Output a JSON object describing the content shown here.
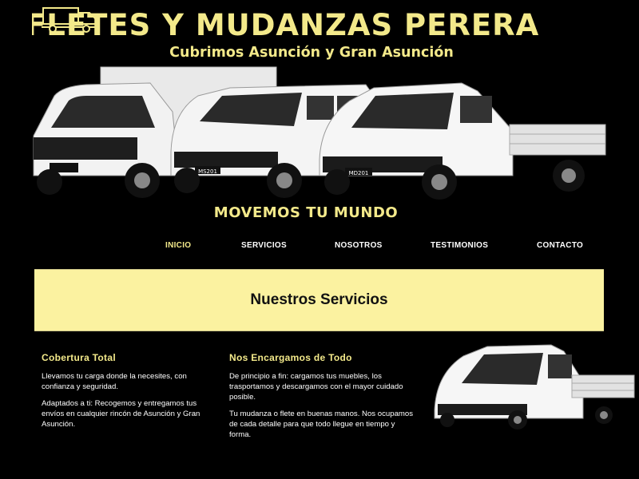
{
  "hero": {
    "title": "FLETES Y MUDANZAS PERERA",
    "subtitle": "Cubrimos Asunción y Gran Asunción",
    "tagline": "MOVEMOS TU MUNDO",
    "truck_plates": [
      "MS201",
      "MD201"
    ]
  },
  "nav": {
    "items": [
      "INICIO",
      "SERVICIOS",
      "NOSOTROS",
      "TESTIMONIOS",
      "CONTACTO"
    ],
    "active": "INICIO"
  },
  "banner": {
    "title": "Nuestros Servicios"
  },
  "services": [
    {
      "title": "Cobertura Total",
      "paragraphs": [
        "Llevamos tu carga donde la necesites, con confianza y seguridad.",
        "Adaptados a ti: Recogemos y entregamos tus envíos en cualquier rincón de Asunción y Gran Asunción."
      ]
    },
    {
      "title": "Nos Encargamos de Todo",
      "paragraphs": [
        "De principio a fin: cargamos tus muebles, los trasportamos y descargamos con el mayor cuidado posible.",
        "Tu mudanza o flete en buenas manos. Nos ocupamos de cada detalle para que todo llegue en tiempo y forma."
      ]
    }
  ],
  "colors": {
    "accent": "#f3e98a",
    "banner_bg": "#fbf2a0",
    "background": "#000000"
  },
  "icons": {
    "logo": "truck-logo-icon"
  }
}
